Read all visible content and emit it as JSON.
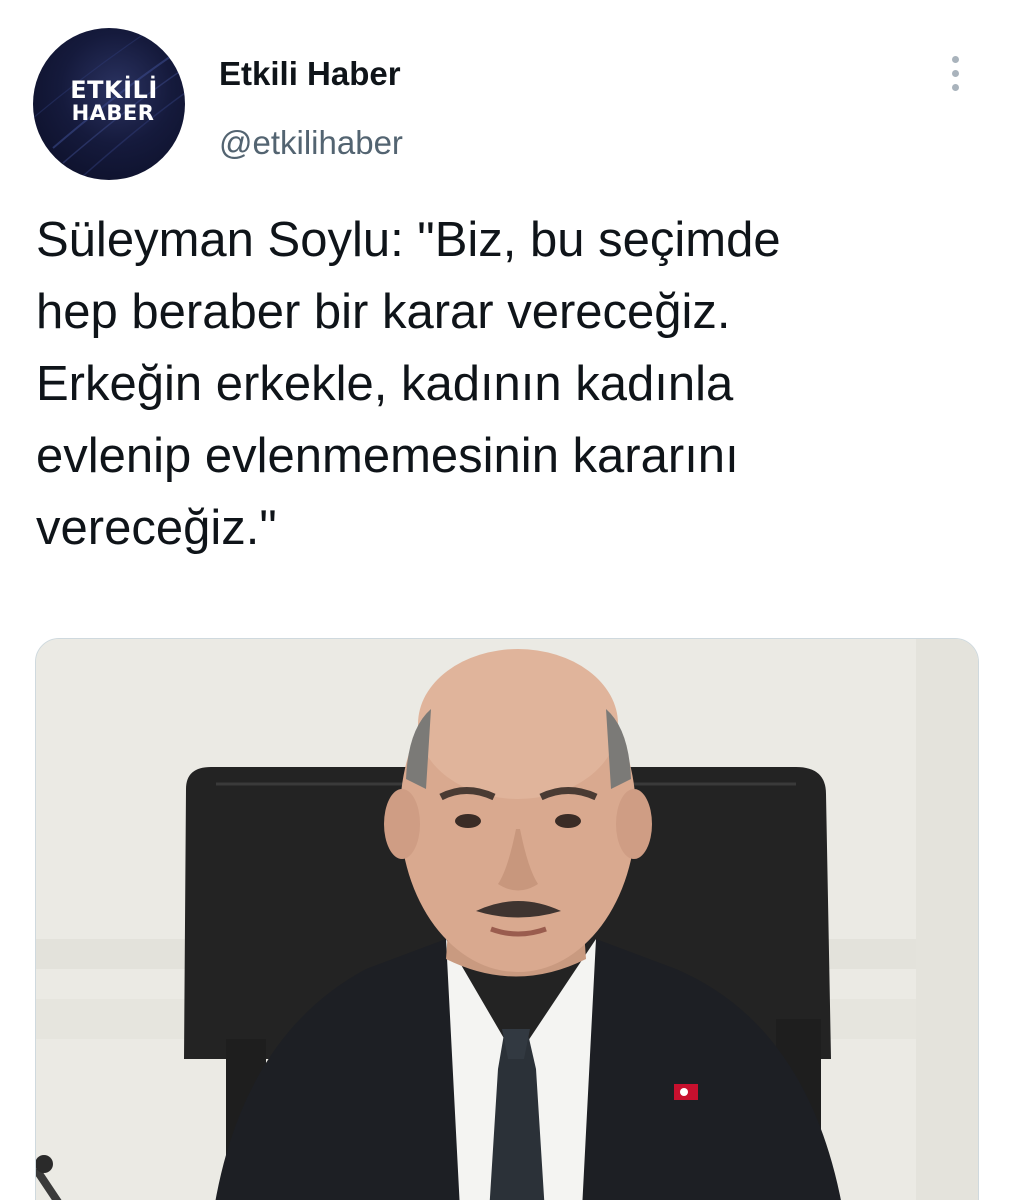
{
  "tweet": {
    "author": {
      "display_name": "Etkili Haber",
      "handle": "@etkilihaber",
      "avatar": {
        "logo_line1": "ETKİLİ",
        "logo_line2": "HABER"
      }
    },
    "more_icon": "more-vertical-icon",
    "text": "Süleyman Soylu: \"Biz, bu seçimde\nhep beraber bir karar vereceğiz.\nErkeğin erkekle, kadının kadınla\nevlenip evlenmemesinin kararını\nvereceğiz.\"",
    "media": {
      "type": "photo"
    }
  },
  "colors": {
    "text_primary": "#0f1419",
    "text_secondary": "#536471",
    "avatar_bg": "#151a3c",
    "icon_gray": "#a9b3bc"
  }
}
